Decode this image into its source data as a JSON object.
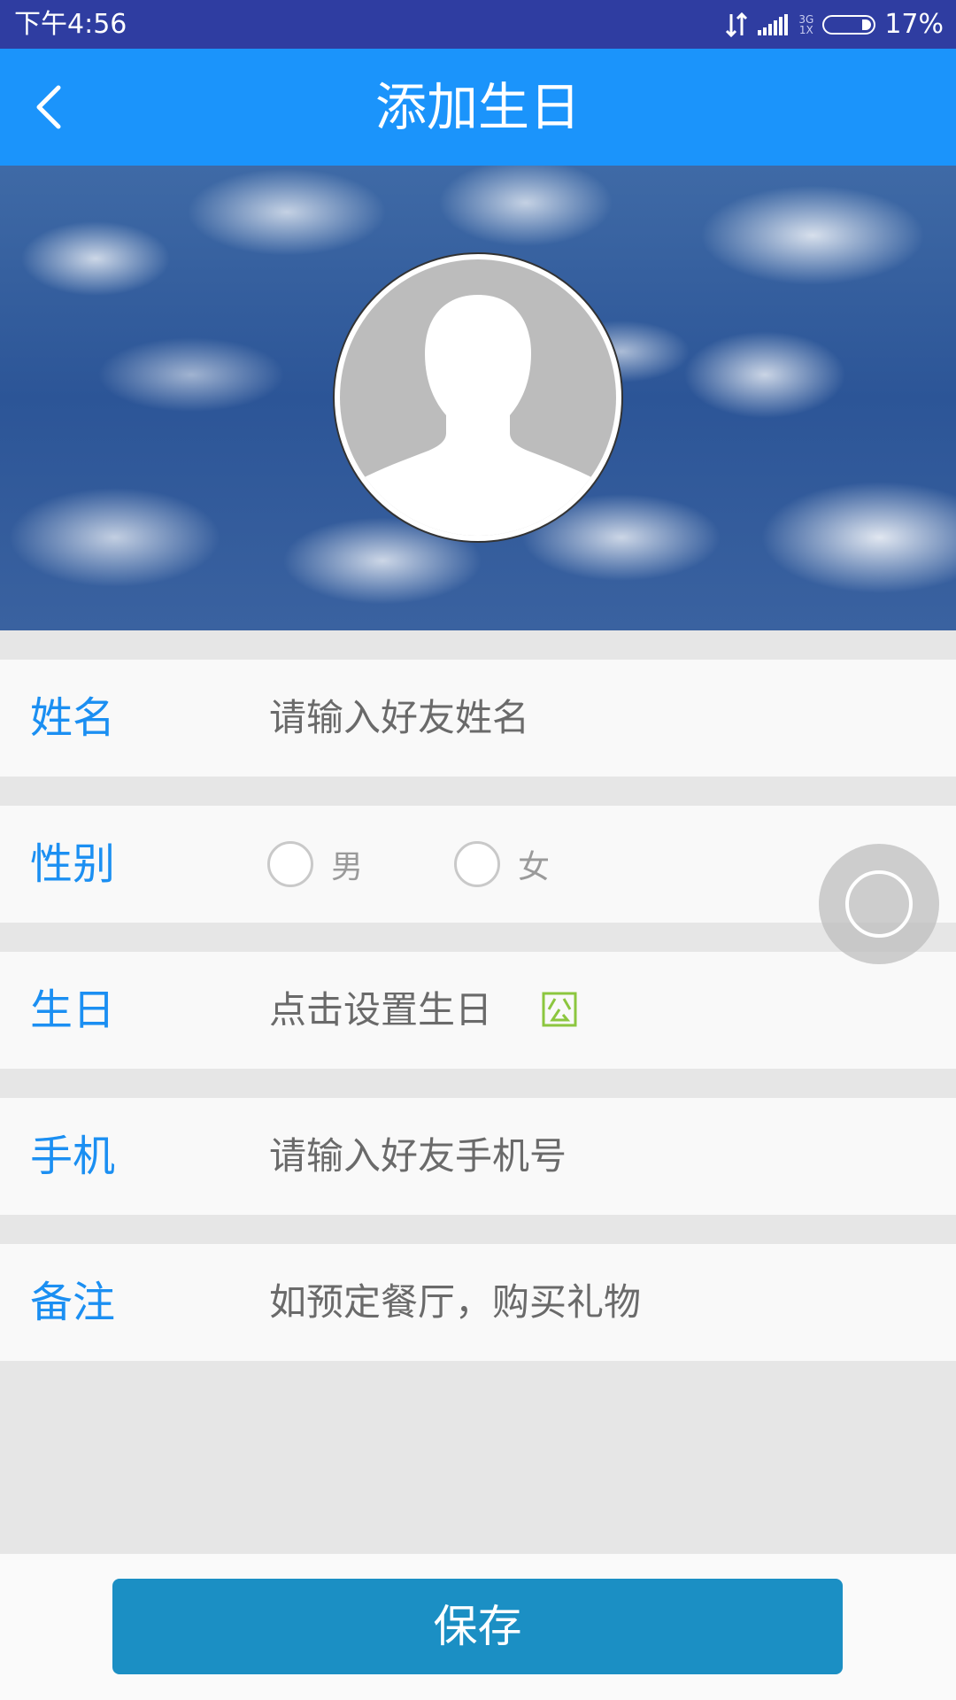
{
  "status_bar": {
    "time": "下午4:56",
    "network_top": "3G",
    "network_bottom": "1X",
    "battery_percent": "17%",
    "battery_level": 0.17
  },
  "app_bar": {
    "title": "添加生日",
    "back_icon": "chevron-left-icon"
  },
  "hero": {
    "avatar_icon": "person-placeholder-icon",
    "background": "cloudy-sky"
  },
  "form": {
    "name": {
      "label": "姓名",
      "placeholder": "请输入好友姓名"
    },
    "gender": {
      "label": "性别",
      "options": [
        "男",
        "女"
      ]
    },
    "birthday": {
      "label": "生日",
      "placeholder": "点击设置生日",
      "icon": "calendar-icon"
    },
    "phone": {
      "label": "手机",
      "placeholder": "请输入好友手机号"
    },
    "note": {
      "label": "备注",
      "placeholder": "如预定餐厅，购买礼物"
    }
  },
  "footer": {
    "save_label": "保存"
  },
  "colors": {
    "status_bar": "#2f3da1",
    "app_bar": "#1b94fb",
    "label": "#1b8ff2",
    "save_button": "#1b8fc4",
    "calendar_icon": "#8cc63f"
  }
}
